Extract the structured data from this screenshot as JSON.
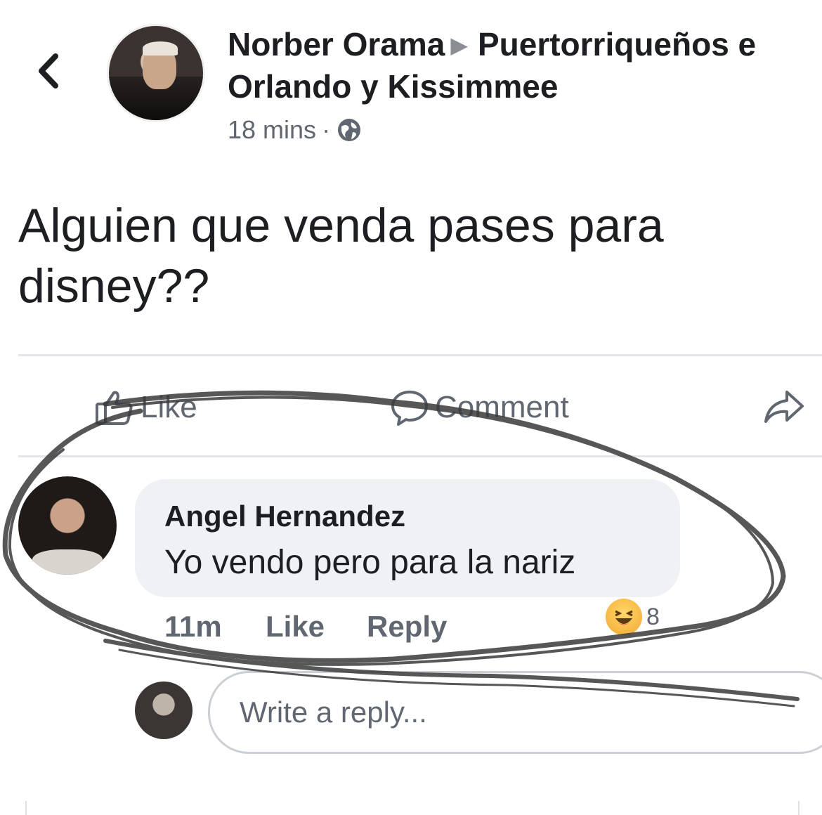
{
  "header": {
    "author": "Norber Orama",
    "group_line1": "Puertorriqueños e",
    "group_line2": "Orlando y Kissimmee",
    "time": "18 mins",
    "separator": "·"
  },
  "post": {
    "text_line1": "Alguien que venda pases para",
    "text_line2": "disney??"
  },
  "actions": {
    "like_label": "Like",
    "comment_label": "Comment"
  },
  "comment": {
    "author": "Angel Hernandez",
    "text": "Yo vendo pero para la nariz",
    "time": "11m",
    "like_label": "Like",
    "reply_label": "Reply",
    "reaction_count": "8"
  },
  "reply_box": {
    "placeholder": "Write a reply..."
  },
  "icons": {
    "back": "chevron-left-icon",
    "globe": "globe-icon",
    "like": "thumbs-up-icon",
    "comment": "speech-bubble-icon",
    "share": "share-arrow-icon",
    "reaction": "haha-emoji-icon"
  },
  "colors": {
    "text_primary": "#1c1e21",
    "text_secondary": "#606770",
    "bubble_bg": "#eff1f4",
    "divider": "#e4e6eb",
    "scribble": "#3a3a3a"
  }
}
